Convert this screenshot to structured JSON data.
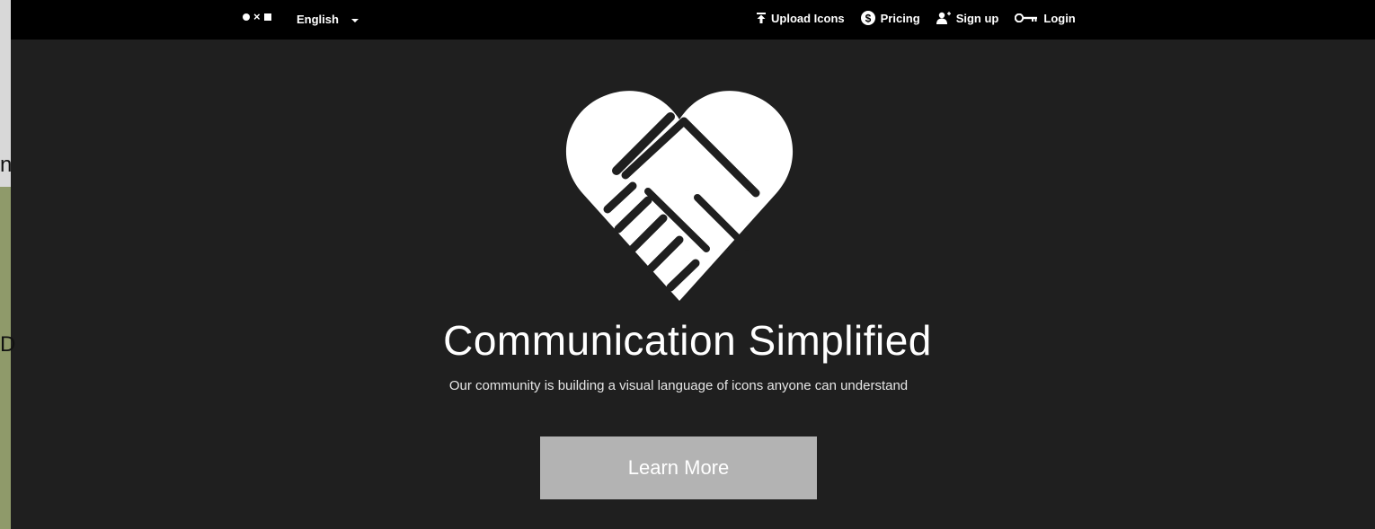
{
  "background_window": {
    "text_fragment_1": "n",
    "text_fragment_2": "D"
  },
  "navbar": {
    "language": "English",
    "links": {
      "upload": "Upload Icons",
      "pricing": "Pricing",
      "signup": "Sign up",
      "login": "Login"
    }
  },
  "hero": {
    "title": "Communication Simplified",
    "subtitle": "Our community is building a visual language of icons anyone can understand",
    "button_label": "Learn More"
  },
  "colors": {
    "navbar_bg": "#000000",
    "page_bg": "#1f1f1f",
    "button_bg": "#b3b3b3"
  }
}
